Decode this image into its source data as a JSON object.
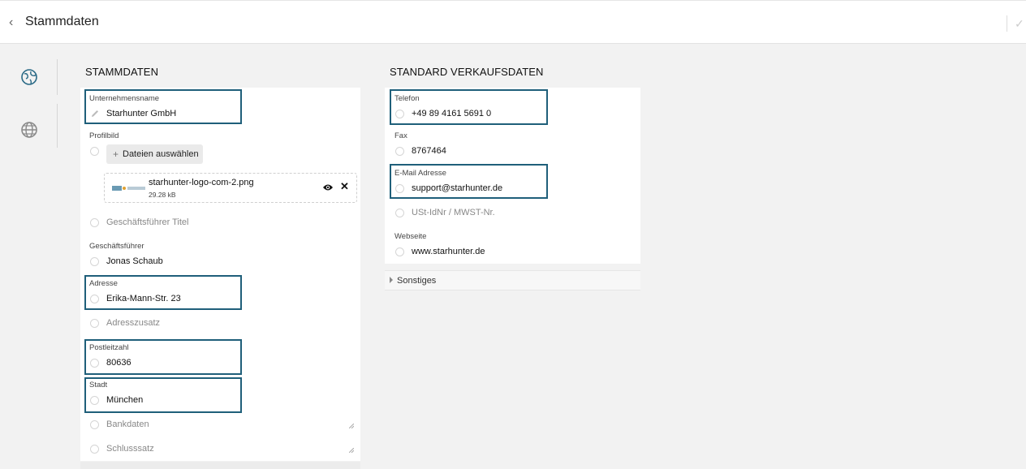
{
  "header": {
    "title": "Stammdaten"
  },
  "sidebar": {
    "items": [
      {
        "icon": "company-globe-icon"
      },
      {
        "icon": "globe-icon"
      }
    ]
  },
  "left": {
    "title": "STAMMDATEN",
    "company_name": {
      "label": "Unternehmensname",
      "value": "Starhunter GmbH"
    },
    "profile_image": {
      "label": "Profilbild",
      "upload_label": "Dateien auswählen",
      "file_name": "starhunter-logo-com-2.png",
      "file_size": "29.28 kB"
    },
    "ceo_title": {
      "placeholder": "Geschäftsführer Titel"
    },
    "ceo": {
      "label": "Geschäftsführer",
      "value": "Jonas Schaub"
    },
    "address": {
      "label": "Adresse",
      "value": "Erika-Mann-Str. 23"
    },
    "address_extra": {
      "placeholder": "Adresszusatz"
    },
    "zip": {
      "label": "Postleitzahl",
      "value": "80636"
    },
    "city": {
      "label": "Stadt",
      "value": "München"
    },
    "bank": {
      "placeholder": "Bankdaten"
    },
    "closing": {
      "placeholder": "Schlusssatz"
    }
  },
  "right": {
    "title": "STANDARD VERKAUFSDATEN",
    "phone": {
      "label": "Telefon",
      "value": "+49 89 4161 5691 0"
    },
    "fax": {
      "label": "Fax",
      "value": "8767464"
    },
    "email": {
      "label": "E-Mail Adresse",
      "value": "support@starhunter.de"
    },
    "vat": {
      "placeholder": "USt-IdNr / MWST-Nr."
    },
    "website": {
      "label": "Webseite",
      "value": "www.starhunter.de"
    },
    "more": {
      "label": "Sonstiges"
    }
  },
  "colors": {
    "highlight": "#1f5f7a",
    "sidebar_icon": "#2a6a86"
  }
}
